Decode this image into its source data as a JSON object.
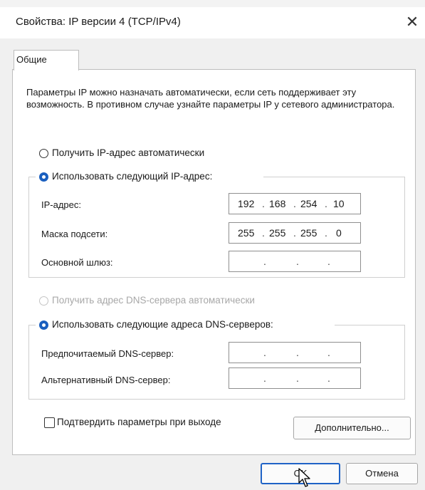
{
  "window": {
    "title": "Свойства: IP версии 4 (TCP/IPv4)",
    "close_glyph": "✕"
  },
  "tabs": [
    {
      "label": "Общие"
    }
  ],
  "description": "Параметры IP можно назначать автоматически, если сеть поддерживает эту возможность. В противном случае узнайте параметры IP у сетевого администратора.",
  "ip_section": {
    "auto_radio_label": "Получить IP-адрес автоматически",
    "manual_radio_label": "Использовать следующий IP-адрес:",
    "selected": "manual",
    "fields": [
      {
        "label": "IP-адрес:",
        "octets": [
          "192",
          "168",
          "254",
          "10"
        ]
      },
      {
        "label": "Маска подсети:",
        "octets": [
          "255",
          "255",
          "255",
          "0"
        ]
      },
      {
        "label": "Основной шлюз:",
        "octets": [
          "",
          "",
          "",
          ""
        ]
      }
    ]
  },
  "dns_section": {
    "auto_radio_label": "Получить адрес DNS-сервера автоматически",
    "auto_disabled": true,
    "manual_radio_label": "Использовать следующие адреса DNS-серверов:",
    "selected": "manual",
    "fields": [
      {
        "label": "Предпочитаемый DNS-сервер:",
        "octets": [
          "",
          "",
          "",
          ""
        ]
      },
      {
        "label": "Альтернативный DNS-сервер:",
        "octets": [
          "",
          "",
          "",
          ""
        ]
      }
    ]
  },
  "validate_checkbox": {
    "label": "Подтвердить параметры при выходе",
    "checked": false
  },
  "buttons": {
    "advanced": "Дополнительно...",
    "ok": "OK",
    "cancel": "Отмена"
  },
  "colors": {
    "accent": "#1a5fbf",
    "dialog_bg": "#f0f0f0"
  }
}
